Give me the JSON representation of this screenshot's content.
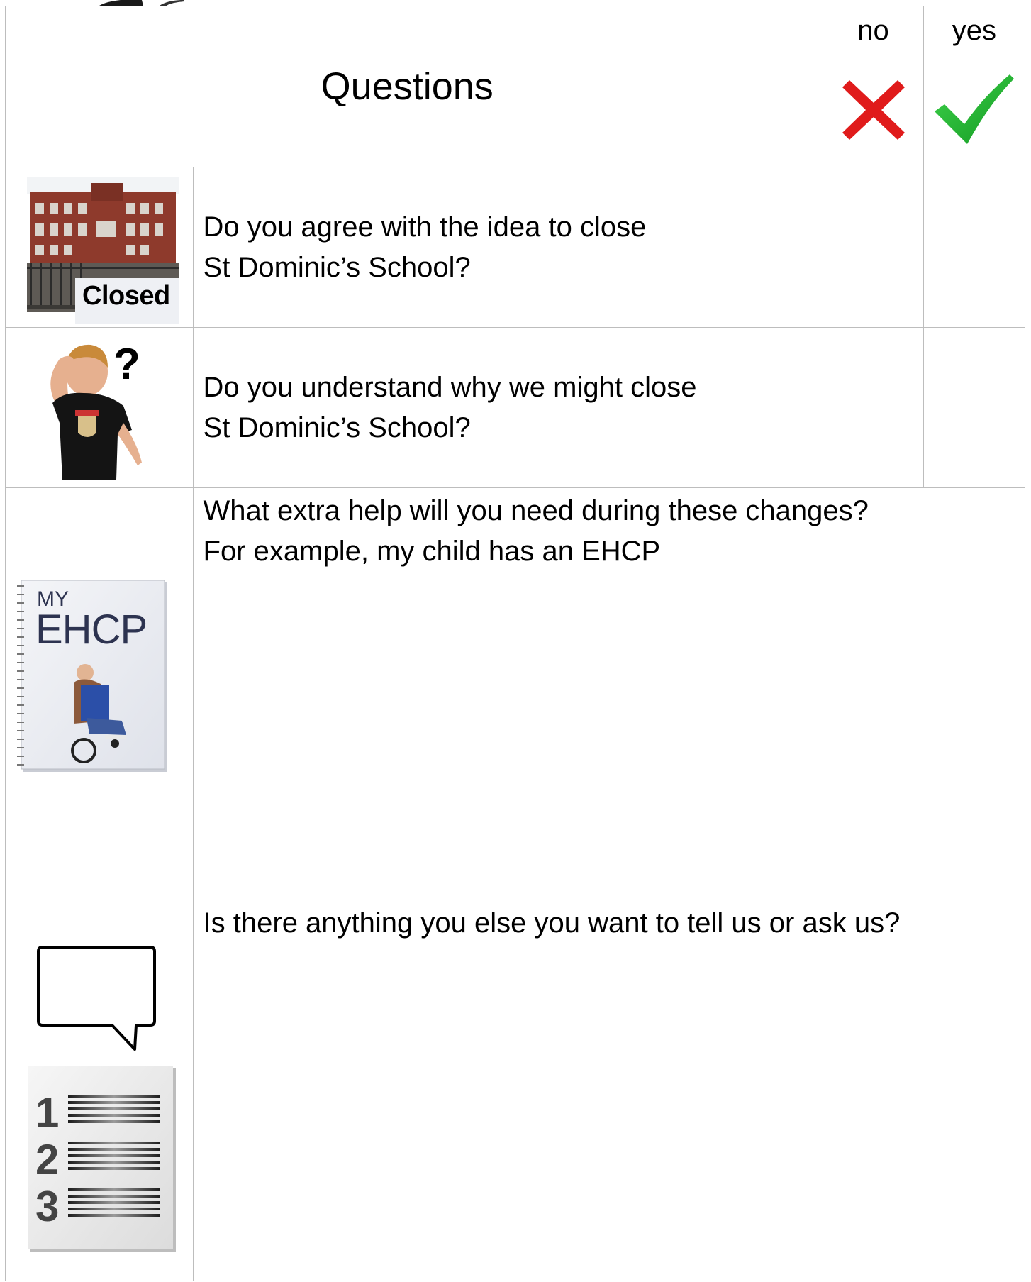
{
  "header": {
    "title": "Questions",
    "no_label": "no",
    "yes_label": "yes"
  },
  "questions": [
    {
      "line1": "Do you agree with the idea to close",
      "line2": "St Dominic’s School?",
      "image_label": "Closed"
    },
    {
      "line1": "Do you understand why we might close",
      "line2": "St Dominic’s School?"
    },
    {
      "line1": "What extra help will you need during these changes?",
      "line2": "For example, my child has an EHCP",
      "image_label_small": "MY",
      "image_label_large": "EHCP"
    },
    {
      "line1": "Is there anything you else you want to tell us or ask us?"
    }
  ],
  "colors": {
    "cross": "#e01b1b",
    "tick": "#1fae2e",
    "border": "#bdbdbd"
  }
}
